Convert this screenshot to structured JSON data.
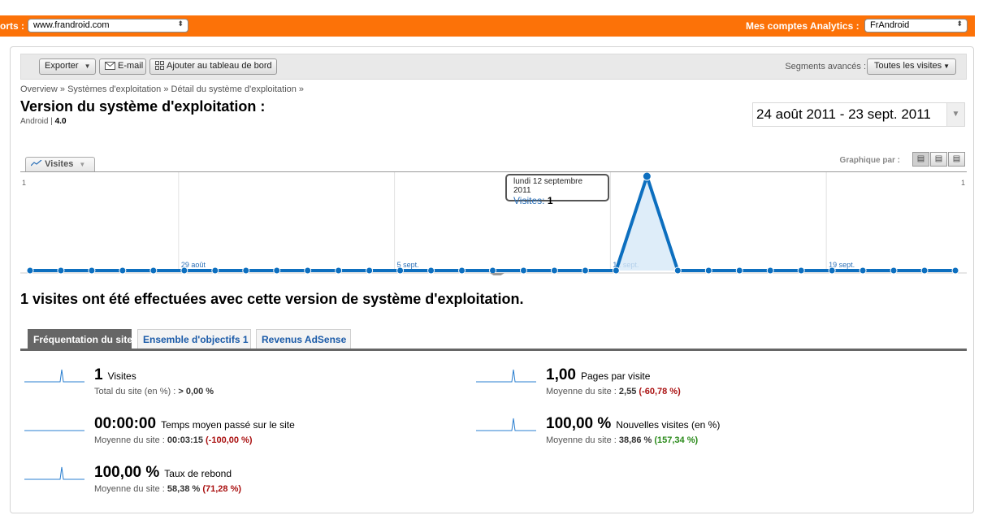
{
  "topbar": {
    "profile_label": "orts :",
    "site_select": "www.frandroid.com",
    "accounts_label": "Mes comptes Analytics :",
    "account_select": "FrAndroid"
  },
  "toolbar": {
    "export": "Exporter",
    "email": "E-mail",
    "dashboard": "Ajouter au tableau de bord",
    "segments_label": "Segments avancés :",
    "segments_value": "Toutes les visites"
  },
  "breadcrumb": "Overview » Systèmes d'exploitation » Détail du système d'exploitation »",
  "page_title": "Version du système d'exploitation :",
  "subtitle": {
    "os": "Android",
    "sep": " | ",
    "version": "4.0"
  },
  "date_range": "24 août 2011 - 23 sept. 2011",
  "chart_tab": "Visites",
  "graph_by": "Graphique par :",
  "chart_data": {
    "type": "area",
    "series": [
      {
        "name": "Visites",
        "values": [
          0,
          0,
          0,
          0,
          0,
          0,
          0,
          0,
          0,
          0,
          0,
          0,
          0,
          0,
          0,
          0,
          0,
          0,
          0,
          0,
          1,
          0,
          0,
          0,
          0,
          0,
          0,
          0,
          0,
          0,
          0
        ]
      }
    ],
    "x_tick_labels": [
      "29 août",
      "5 sept.",
      "12 sept.",
      "19 sept."
    ],
    "y_tick_labels": [
      "1",
      "1"
    ],
    "ylim": [
      0,
      1
    ],
    "color": "#0d6fbf"
  },
  "tooltip": {
    "date": "lundi 12 septembre 2011",
    "label": "Visites:",
    "value": "1"
  },
  "summary": "1 visites ont été effectuées avec cette version de système d'exploitation.",
  "tabs": [
    "Fréquentation du site",
    "Ensemble d'objectifs 1",
    "Revenus AdSense"
  ],
  "metrics": [
    {
      "value": "1",
      "name": "Visites",
      "sub_label": "Total du site (en %) :",
      "sub_value": "> 0,00 %",
      "delta": ""
    },
    {
      "value": "1,00",
      "name": "Pages par visite",
      "sub_label": "Moyenne du site :",
      "sub_value": "2,55",
      "delta": "(-60,78 %)"
    },
    {
      "value": "00:00:00",
      "name": "Temps moyen passé sur le site",
      "sub_label": "Moyenne du site :",
      "sub_value": "00:03:15",
      "delta": "(-100,00 %)"
    },
    {
      "value": "100,00 %",
      "name": "Nouvelles visites (en %)",
      "sub_label": "Moyenne du site :",
      "sub_value": "38,86 %",
      "delta": "(157,34 %)"
    },
    {
      "value": "100,00 %",
      "name": "Taux de rebond",
      "sub_label": "Moyenne du site :",
      "sub_value": "58,38 %",
      "delta": "(71,28 %)"
    }
  ]
}
